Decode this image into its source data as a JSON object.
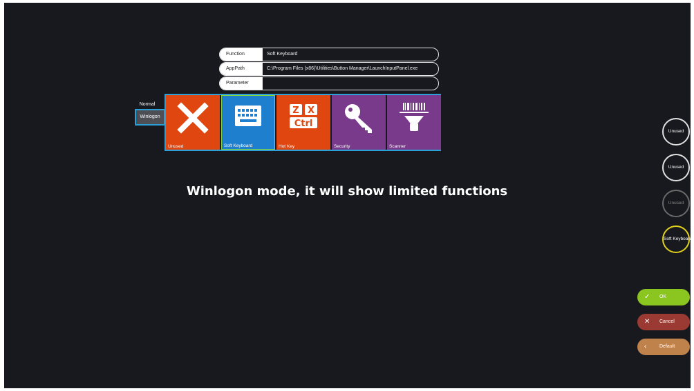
{
  "fields": [
    {
      "label": "Function",
      "value": "Soft Keyboard"
    },
    {
      "label": "AppPath",
      "value": "C:\\Program Files (x86)\\Utilities\\Button Manager\\LaunchInputPanel.exe"
    },
    {
      "label": "Parameter",
      "value": ""
    }
  ],
  "modes": {
    "normal": "Normal",
    "winlogon": "Winlogon"
  },
  "tiles": [
    {
      "label": "Unused",
      "icon": "x-icon",
      "color": "#e0460f"
    },
    {
      "label": "Soft Keyboard",
      "icon": "keyboard-icon",
      "color": "#1e7fcf"
    },
    {
      "label": "Hot Key",
      "icon": "hotkey-icon",
      "color": "#e0460f",
      "keys": [
        "Z",
        "X",
        "Ctrl"
      ]
    },
    {
      "label": "Security",
      "icon": "key-icon",
      "color": "#7a3a8c"
    },
    {
      "label": "Scanner",
      "icon": "barcode-scanner-icon",
      "color": "#7a3a8c"
    }
  ],
  "caption": "Winlogon mode, it will show limited functions",
  "slots": [
    "Unused",
    "Unused",
    "Unused",
    "Soft Keyboard"
  ],
  "buttons": {
    "ok": "OK",
    "cancel": "Cancel",
    "default": "Default"
  },
  "colors": {
    "accent_blue": "#2a9fd8",
    "selected_green": "#8bd33a",
    "active_slot": "#e1d21c"
  }
}
